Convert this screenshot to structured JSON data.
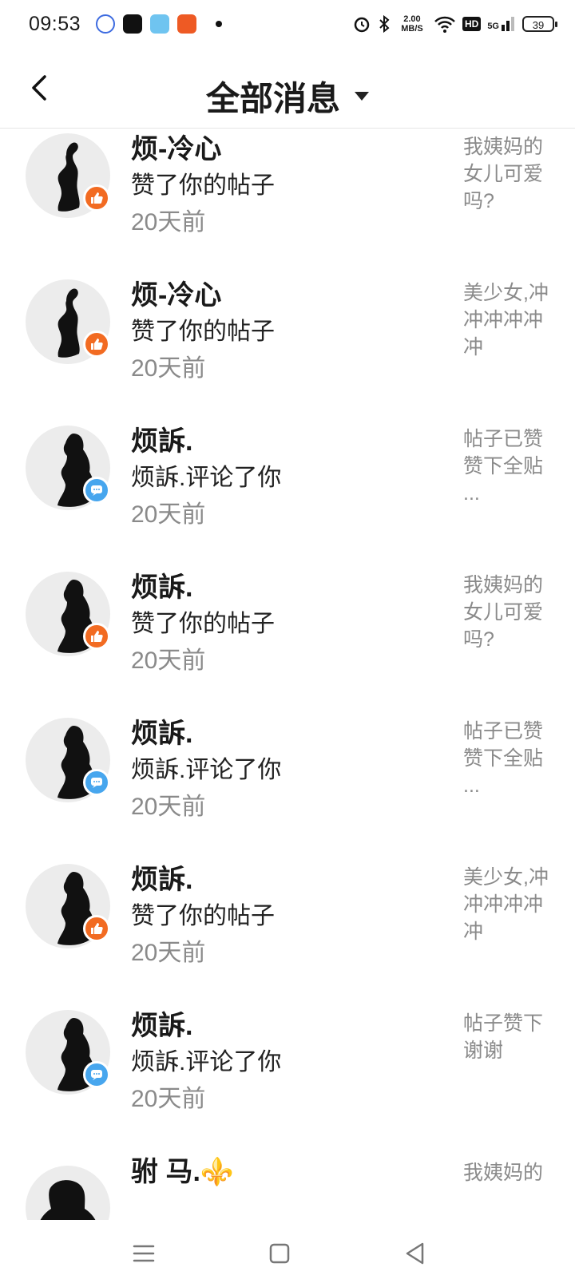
{
  "status_bar": {
    "time": "09:53",
    "net_speed": "2.00 MB/S",
    "hd": "HD",
    "signal": "5G",
    "battery": "39"
  },
  "header": {
    "title": "全部消息"
  },
  "messages": [
    {
      "name": "烦-冷心",
      "action": "赞了你的帖子",
      "time": "20天前",
      "type": "like",
      "preview": "我姨妈的女儿可爱吗?"
    },
    {
      "name": "烦-冷心",
      "action": "赞了你的帖子",
      "time": "20天前",
      "type": "like",
      "preview": "美少女,冲冲冲冲冲冲"
    },
    {
      "name": "烦訴.",
      "action": "烦訴.评论了你",
      "time": "20天前",
      "type": "comment",
      "preview": "帖子已赞赞下全贴 ..."
    },
    {
      "name": "烦訴.",
      "action": "赞了你的帖子",
      "time": "20天前",
      "type": "like",
      "preview": "我姨妈的女儿可爱吗?"
    },
    {
      "name": "烦訴.",
      "action": "烦訴.评论了你",
      "time": "20天前",
      "type": "comment",
      "preview": "帖子已赞赞下全贴 ..."
    },
    {
      "name": "烦訴.",
      "action": "赞了你的帖子",
      "time": "20天前",
      "type": "like",
      "preview": "美少女,冲冲冲冲冲冲"
    },
    {
      "name": "烦訴.",
      "action": "烦訴.评论了你",
      "time": "20天前",
      "type": "comment",
      "preview": "帖子赞下谢谢"
    },
    {
      "name": "驸 马.⚜️",
      "action": "",
      "time": "",
      "type": "",
      "preview": "我姨妈的"
    }
  ],
  "icons": {
    "back": "chevron-left-icon",
    "like_badge": "thumbs-up-icon",
    "comment_badge": "chat-bubble-icon",
    "nav_menu": "menu-icon",
    "nav_home": "square-icon",
    "nav_back": "triangle-back-icon"
  },
  "colors": {
    "like": "#f26b22",
    "comment": "#47a6ee",
    "secondary_text": "#8a8a8a"
  }
}
